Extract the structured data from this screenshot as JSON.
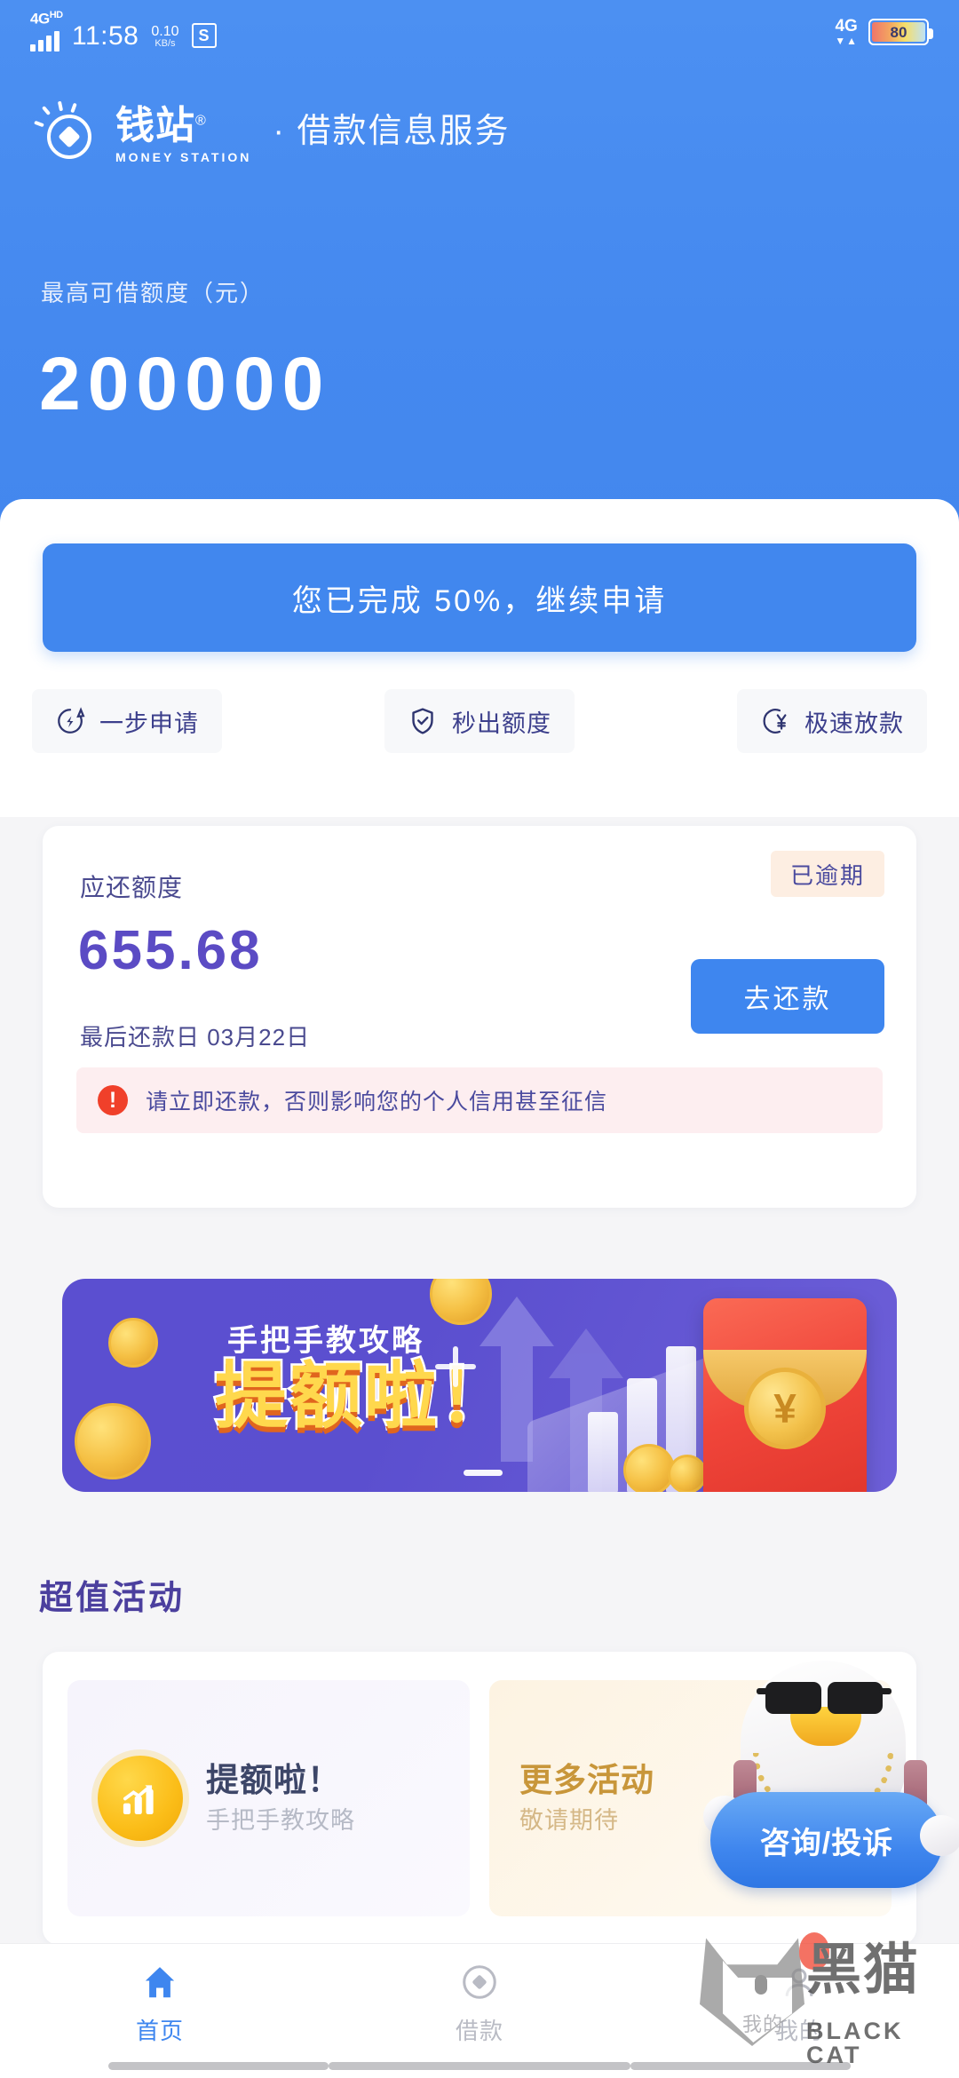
{
  "status_bar": {
    "network_type": "4G",
    "network_suffix": "HD",
    "time": "11:58",
    "speed_value": "0.10",
    "speed_unit": "KB/s",
    "app_badge": "S",
    "mobile_data": "4G",
    "data_arrows": "▼▲",
    "battery_percent": "80"
  },
  "header": {
    "brand_cn": "钱站",
    "brand_reg": "®",
    "brand_en": "MONEY STATION",
    "brand_subtitle": "· 借款信息服务",
    "quota_label": "最高可借额度（元）",
    "quota_value": "200000",
    "accent_color": "#4589ef"
  },
  "apply": {
    "button_label": "您已完成 50%，继续申请",
    "progress_percent": 50,
    "features": [
      {
        "label": "一步申请",
        "icon": "lightning-icon"
      },
      {
        "label": "秒出额度",
        "icon": "shield-check-icon"
      },
      {
        "label": "极速放款",
        "icon": "yuan-circle-icon"
      }
    ]
  },
  "repayment": {
    "title": "应还额度",
    "amount": "655.68",
    "due_text": "最后还款日 03月22日",
    "status_badge": "已逾期",
    "action_label": "去还款",
    "warning": "请立即还款，否则影响您的个人信用甚至征信",
    "warning_color": "#f0402a",
    "badge_color": "#fdeee2"
  },
  "banner": {
    "subtitle": "手把手教攻略",
    "title": "提额啦！",
    "envelope_symbol": "¥"
  },
  "activities": {
    "section_title": "超值活动",
    "cards": [
      {
        "title": "提额啦！",
        "subtitle": "手把手教攻略",
        "icon": "growth-chart-icon"
      },
      {
        "title": "更多活动",
        "subtitle": "敬请期待",
        "icon": "none"
      }
    ],
    "mascot_button": "咨询/投诉"
  },
  "tabbar": {
    "items": [
      {
        "label": "首页",
        "icon": "home-icon",
        "active": true
      },
      {
        "label": "借款",
        "icon": "diamond-circle-icon",
        "active": false
      },
      {
        "label": "我的",
        "icon": "user-icon",
        "active": false
      }
    ],
    "active_color": "#3e86ef"
  },
  "watermark": {
    "text_cn": "黑猫",
    "text_en": "BLACK CAT",
    "small_label": "我的"
  }
}
